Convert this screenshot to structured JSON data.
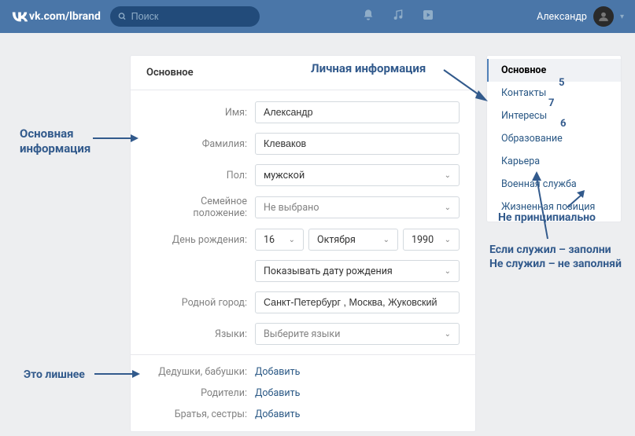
{
  "header": {
    "url": "vk.com/lbrand",
    "search_placeholder": "Поиск",
    "username": "Александр"
  },
  "main": {
    "title": "Основное",
    "fields": {
      "name_label": "Имя:",
      "name_value": "Александр",
      "surname_label": "Фамилия:",
      "surname_value": "Клеваков",
      "gender_label": "Пол:",
      "gender_value": "мужской",
      "marital_label": "Семейное положение:",
      "marital_value": "Не выбрано",
      "dob_label": "День рождения:",
      "dob_day": "16",
      "dob_month": "Октября",
      "dob_year": "1990",
      "dob_visibility": "Показывать дату рождения",
      "hometown_label": "Родной город:",
      "hometown_value": "Санкт-Петербург , Москва, Жуковский",
      "languages_label": "Языки:",
      "languages_value": "Выберите языки",
      "grandparents_label": "Дедушки, бабушки:",
      "parents_label": "Родители:",
      "siblings_label": "Братья, сестры:",
      "add_link": "Добавить"
    }
  },
  "sidebar": {
    "items": [
      "Основное",
      "Контакты",
      "Интересы",
      "Образование",
      "Карьера",
      "Военная служба",
      "Жизненная позиция"
    ]
  },
  "annotations": {
    "personal_info": "Личная информация",
    "main_info_l1": "Основная",
    "main_info_l2": "информация",
    "extra": "Это лишнее",
    "not_important": "Не принципиально",
    "served_l1": "Если служил – заполни",
    "served_l2": "Не служил – не заполняй",
    "n5": "5",
    "n6": "6",
    "n7": "7"
  }
}
